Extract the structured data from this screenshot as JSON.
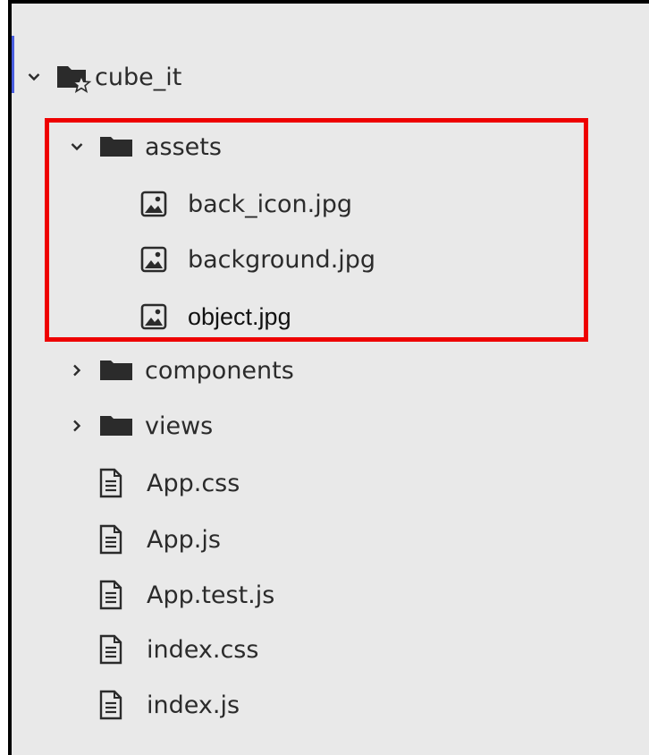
{
  "tree": {
    "root": {
      "label": "cube_it",
      "icon": "project-folder-star-icon",
      "expanded": true
    },
    "assets": {
      "label": "assets",
      "icon": "folder-icon",
      "expanded": true,
      "files": [
        {
          "label": "back_icon.jpg",
          "icon": "image-file-icon"
        },
        {
          "label": "background.jpg",
          "icon": "image-file-icon"
        },
        {
          "label": "object.jpg",
          "icon": "image-file-icon"
        }
      ]
    },
    "components": {
      "label": "components",
      "icon": "folder-icon",
      "expanded": false
    },
    "views": {
      "label": "views",
      "icon": "folder-icon",
      "expanded": false
    },
    "files": [
      {
        "label": "App.css",
        "icon": "text-file-icon"
      },
      {
        "label": "App.js",
        "icon": "text-file-icon"
      },
      {
        "label": "App.test.js",
        "icon": "text-file-icon"
      },
      {
        "label": "index.css",
        "icon": "text-file-icon"
      },
      {
        "label": "index.js",
        "icon": "text-file-icon"
      }
    ]
  },
  "colors": {
    "background": "#e9e9e9",
    "highlight_border": "#ee0000",
    "focus_indicator": "#4a5fe0",
    "icon": "#2b2b2b"
  }
}
